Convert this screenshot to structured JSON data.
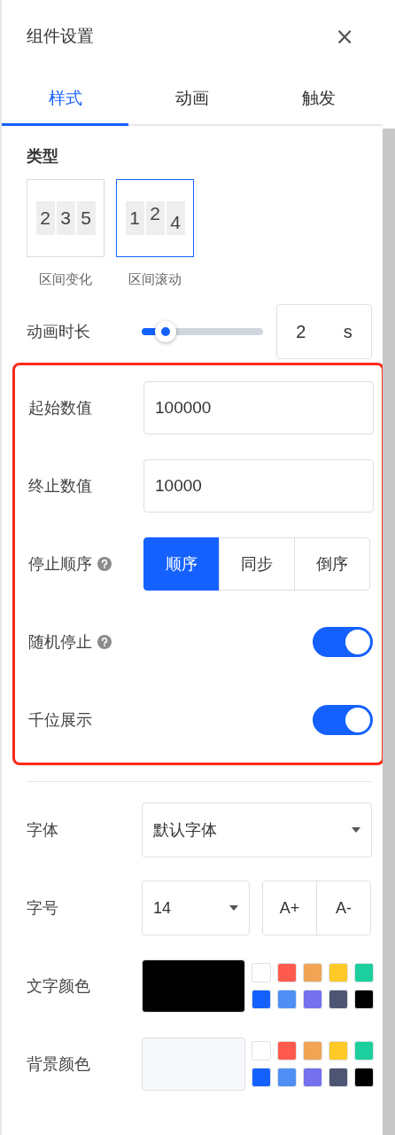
{
  "panel": {
    "title": "组件设置",
    "close": "×"
  },
  "tabs": [
    {
      "label": "样式",
      "selected": true
    },
    {
      "label": "动画",
      "selected": false
    },
    {
      "label": "触发",
      "selected": false
    }
  ],
  "type": {
    "label": "类型",
    "options": [
      {
        "label": "区间变化",
        "kind": "change",
        "digits": [
          "2",
          "3",
          "5"
        ],
        "selected": false
      },
      {
        "label": "区间滚动",
        "kind": "scroll",
        "digits": [
          "1",
          "2",
          "4"
        ],
        "selected": true
      }
    ]
  },
  "duration": {
    "label": "动画时长",
    "level": 0.2,
    "value": "2",
    "unit": "s"
  },
  "highlighted": [
    {
      "kind": "input",
      "label": "起始数值",
      "value": "100000"
    },
    {
      "kind": "input",
      "label": "终止数值",
      "value": "10000"
    },
    {
      "kind": "segmented",
      "label": "停止顺序",
      "help": true,
      "options": [
        {
          "label": "顺序",
          "selected": true
        },
        {
          "label": "同步",
          "selected": false
        },
        {
          "label": "倒序",
          "selected": false
        }
      ]
    },
    {
      "kind": "switch",
      "label": "随机停止",
      "help": true,
      "on": true
    },
    {
      "kind": "switch",
      "label": "千位展示",
      "help": false,
      "on": true
    }
  ],
  "font": {
    "label": "字体",
    "value": "默认字体"
  },
  "size": {
    "label": "字号",
    "value": "14",
    "buttons": [
      "A+",
      "A-"
    ]
  },
  "colors": [
    {
      "label": "文字颜色",
      "color": "#000000",
      "palette": [
        {
          "color": "#ffffff"
        },
        {
          "color": "#ff5a4e"
        },
        {
          "color": "#f0a454"
        },
        {
          "color": "#ffc928"
        },
        {
          "color": "#1ccf9c"
        },
        {
          "color": "#1561ff"
        },
        {
          "color": "#4f8ff3"
        },
        {
          "color": "#7470ee"
        },
        {
          "color": "#4e5573"
        },
        {
          "color": "#000000"
        }
      ]
    },
    {
      "label": "背景颜色",
      "color": "#f7f8fa",
      "palette": [
        {
          "color": "#ffffff"
        },
        {
          "color": "#ff5a4e"
        },
        {
          "color": "#f0a454"
        },
        {
          "color": "#ffc928"
        },
        {
          "color": "#1ccf9c"
        },
        {
          "color": "#1561ff"
        },
        {
          "color": "#4f8ff3"
        },
        {
          "color": "#7470ee"
        },
        {
          "color": "#4e5573"
        },
        {
          "color": "#000000"
        }
      ]
    }
  ]
}
